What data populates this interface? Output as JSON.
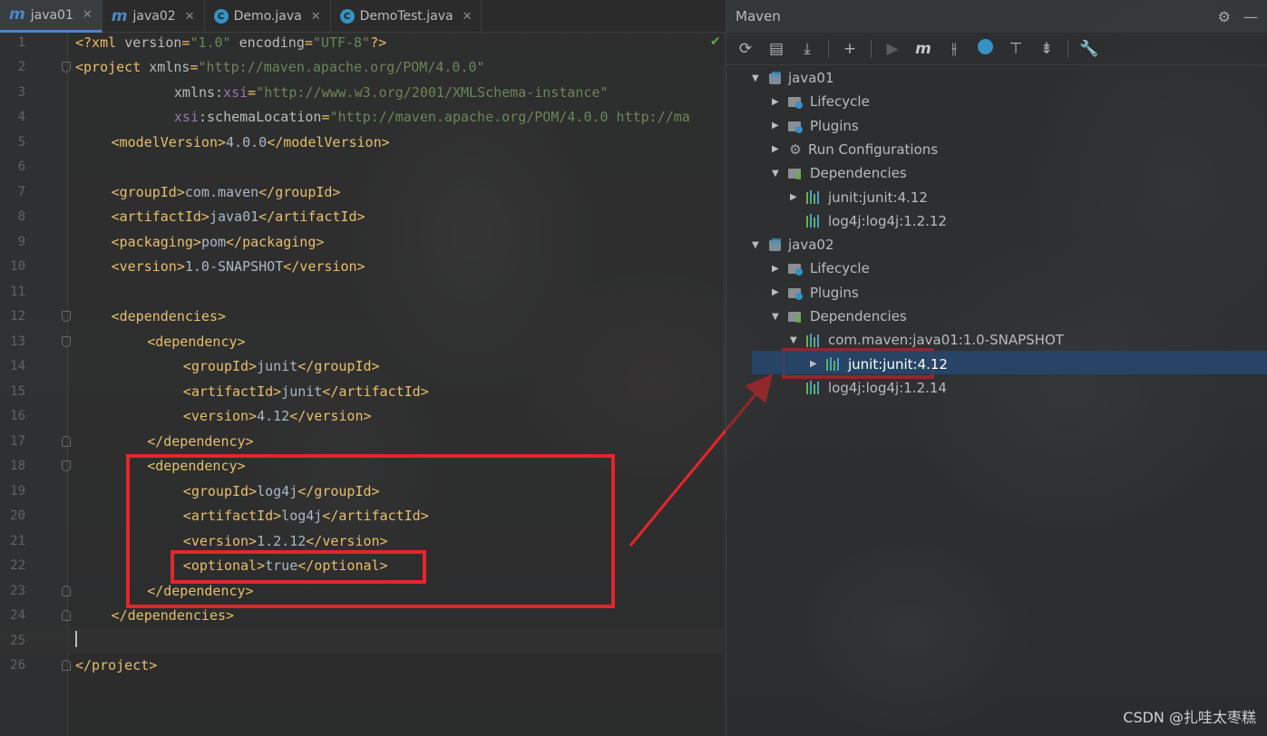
{
  "tabs": [
    {
      "label": "java01",
      "icon": "maven-m-icon",
      "active": true
    },
    {
      "label": "java02",
      "icon": "maven-m-icon",
      "active": false
    },
    {
      "label": "Demo.java",
      "icon": "class-icon",
      "active": false
    },
    {
      "label": "DemoTest.java",
      "icon": "class-icon",
      "active": false
    }
  ],
  "editor": {
    "lines": [
      {
        "n": "1",
        "indent": 0,
        "segs": [
          [
            "t",
            "<?xml "
          ],
          [
            "an",
            "version"
          ],
          [
            "t",
            "="
          ],
          [
            "av",
            "\"1.0\""
          ],
          [
            "t",
            " "
          ],
          [
            "an",
            "encoding"
          ],
          [
            "t",
            "="
          ],
          [
            "av",
            "\"UTF-8\""
          ],
          [
            "t",
            "?>"
          ]
        ]
      },
      {
        "n": "2",
        "indent": 0,
        "segs": [
          [
            "t",
            "<project "
          ],
          [
            "an",
            "xmlns"
          ],
          [
            "t",
            "="
          ],
          [
            "av",
            "\"http://maven.apache.org/POM/4.0.0\""
          ]
        ]
      },
      {
        "n": "3",
        "indent": 11,
        "segs": [
          [
            "an",
            "xmlns:"
          ],
          [
            "ns",
            "xsi"
          ],
          [
            "t",
            "="
          ],
          [
            "av",
            "\"http://www.w3.org/2001/XMLSchema-instance\""
          ]
        ]
      },
      {
        "n": "4",
        "indent": 11,
        "segs": [
          [
            "ns",
            "xsi"
          ],
          [
            "an",
            ":schemaLocation"
          ],
          [
            "t",
            "="
          ],
          [
            "av",
            "\"http://maven.apache.org/POM/4.0.0 http://ma"
          ]
        ]
      },
      {
        "n": "5",
        "indent": 4,
        "segs": [
          [
            "t",
            "<modelVersion>"
          ],
          [
            "txt",
            "4.0.0"
          ],
          [
            "t",
            "</modelVersion>"
          ]
        ]
      },
      {
        "n": "6",
        "indent": 0,
        "segs": []
      },
      {
        "n": "7",
        "indent": 4,
        "segs": [
          [
            "t",
            "<groupId>"
          ],
          [
            "txt",
            "com.maven"
          ],
          [
            "t",
            "</groupId>"
          ]
        ]
      },
      {
        "n": "8",
        "indent": 4,
        "segs": [
          [
            "t",
            "<artifactId>"
          ],
          [
            "txt",
            "java01"
          ],
          [
            "t",
            "</artifactId>"
          ]
        ]
      },
      {
        "n": "9",
        "indent": 4,
        "segs": [
          [
            "t",
            "<packaging>"
          ],
          [
            "txt",
            "pom"
          ],
          [
            "t",
            "</packaging>"
          ]
        ]
      },
      {
        "n": "10",
        "indent": 4,
        "segs": [
          [
            "t",
            "<version>"
          ],
          [
            "txt",
            "1.0-SNAPSHOT"
          ],
          [
            "t",
            "</version>"
          ]
        ]
      },
      {
        "n": "11",
        "indent": 0,
        "segs": []
      },
      {
        "n": "12",
        "indent": 4,
        "segs": [
          [
            "t",
            "<dependencies>"
          ]
        ]
      },
      {
        "n": "13",
        "indent": 8,
        "segs": [
          [
            "t",
            "<dependency>"
          ]
        ]
      },
      {
        "n": "14",
        "indent": 12,
        "segs": [
          [
            "t",
            "<groupId>"
          ],
          [
            "txt",
            "junit"
          ],
          [
            "t",
            "</groupId>"
          ]
        ]
      },
      {
        "n": "15",
        "indent": 12,
        "segs": [
          [
            "t",
            "<artifactId>"
          ],
          [
            "txt",
            "junit"
          ],
          [
            "t",
            "</artifactId>"
          ]
        ]
      },
      {
        "n": "16",
        "indent": 12,
        "segs": [
          [
            "t",
            "<version>"
          ],
          [
            "txt",
            "4.12"
          ],
          [
            "t",
            "</version>"
          ]
        ]
      },
      {
        "n": "17",
        "indent": 8,
        "segs": [
          [
            "t",
            "</dependency>"
          ]
        ]
      },
      {
        "n": "18",
        "indent": 8,
        "segs": [
          [
            "t",
            "<dependency>"
          ]
        ]
      },
      {
        "n": "19",
        "indent": 12,
        "segs": [
          [
            "t",
            "<groupId>"
          ],
          [
            "txt",
            "log4j"
          ],
          [
            "t",
            "</groupId>"
          ]
        ]
      },
      {
        "n": "20",
        "indent": 12,
        "segs": [
          [
            "t",
            "<artifactId>"
          ],
          [
            "txt",
            "log4j"
          ],
          [
            "t",
            "</artifactId>"
          ]
        ]
      },
      {
        "n": "21",
        "indent": 12,
        "segs": [
          [
            "t",
            "<version>"
          ],
          [
            "txt",
            "1.2.12"
          ],
          [
            "t",
            "</version>"
          ]
        ]
      },
      {
        "n": "22",
        "indent": 12,
        "segs": [
          [
            "t",
            "<optional>"
          ],
          [
            "txt",
            "true"
          ],
          [
            "t",
            "</optional>"
          ]
        ]
      },
      {
        "n": "23",
        "indent": 8,
        "segs": [
          [
            "t",
            "</dependency>"
          ]
        ]
      },
      {
        "n": "24",
        "indent": 4,
        "segs": [
          [
            "t",
            "</dependencies>"
          ]
        ]
      },
      {
        "n": "25",
        "indent": 0,
        "segs": [],
        "current": true
      },
      {
        "n": "26",
        "indent": 0,
        "segs": [
          [
            "t",
            "</project>"
          ]
        ]
      }
    ],
    "fold_lines": [
      "2",
      "12",
      "13",
      "17",
      "18",
      "23",
      "24",
      "26"
    ],
    "fold_end_lines": [
      "17",
      "23",
      "24",
      "26"
    ]
  },
  "maven": {
    "title": "Maven",
    "tree": [
      {
        "level": 0,
        "caret": "▼",
        "icon": "module",
        "label": "java01"
      },
      {
        "level": 1,
        "caret": "▶",
        "icon": "folder",
        "label": "Lifecycle"
      },
      {
        "level": 1,
        "caret": "▶",
        "icon": "folder",
        "label": "Plugins"
      },
      {
        "level": 1,
        "caret": "▶",
        "icon": "gear",
        "label": "Run Configurations"
      },
      {
        "level": 1,
        "caret": "▼",
        "icon": "deps",
        "label": "Dependencies"
      },
      {
        "level": 2,
        "caret": "▶",
        "icon": "lib",
        "label": "junit:junit:4.12"
      },
      {
        "level": 2,
        "caret": "",
        "icon": "lib",
        "label": "log4j:log4j:1.2.12"
      },
      {
        "level": 0,
        "caret": "▼",
        "icon": "module",
        "label": "java02"
      },
      {
        "level": 1,
        "caret": "▶",
        "icon": "folder",
        "label": "Lifecycle"
      },
      {
        "level": 1,
        "caret": "▶",
        "icon": "folder",
        "label": "Plugins"
      },
      {
        "level": 1,
        "caret": "▼",
        "icon": "deps",
        "label": "Dependencies"
      },
      {
        "level": 2,
        "caret": "▼",
        "icon": "lib",
        "label": "com.maven:java01:1.0-SNAPSHOT"
      },
      {
        "level": 3,
        "caret": "▶",
        "icon": "lib",
        "label": "junit:junit:4.12",
        "selected": true
      },
      {
        "level": 2,
        "caret": "",
        "icon": "lib",
        "label": "log4j:log4j:1.2.14"
      }
    ]
  },
  "watermark": "CSDN @扎哇太枣糕",
  "colors": {
    "highlight": "#e3262b",
    "accent": "#4a88c7",
    "tag": "#e8bf6a",
    "string": "#6a8759"
  }
}
